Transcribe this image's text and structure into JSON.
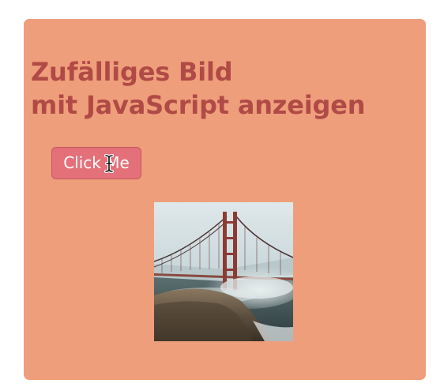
{
  "page": {
    "heading_line1": "Zufälliges Bild",
    "heading_line2": "mit JavaScript anzeigen"
  },
  "button": {
    "label": "Click Me"
  },
  "image": {
    "icon": "golden-gate-bridge-photo"
  },
  "colors": {
    "card_background": "#ef9e7b",
    "heading": "#b04a46",
    "button_background": "#e4707a",
    "button_text": "#ffffff"
  }
}
